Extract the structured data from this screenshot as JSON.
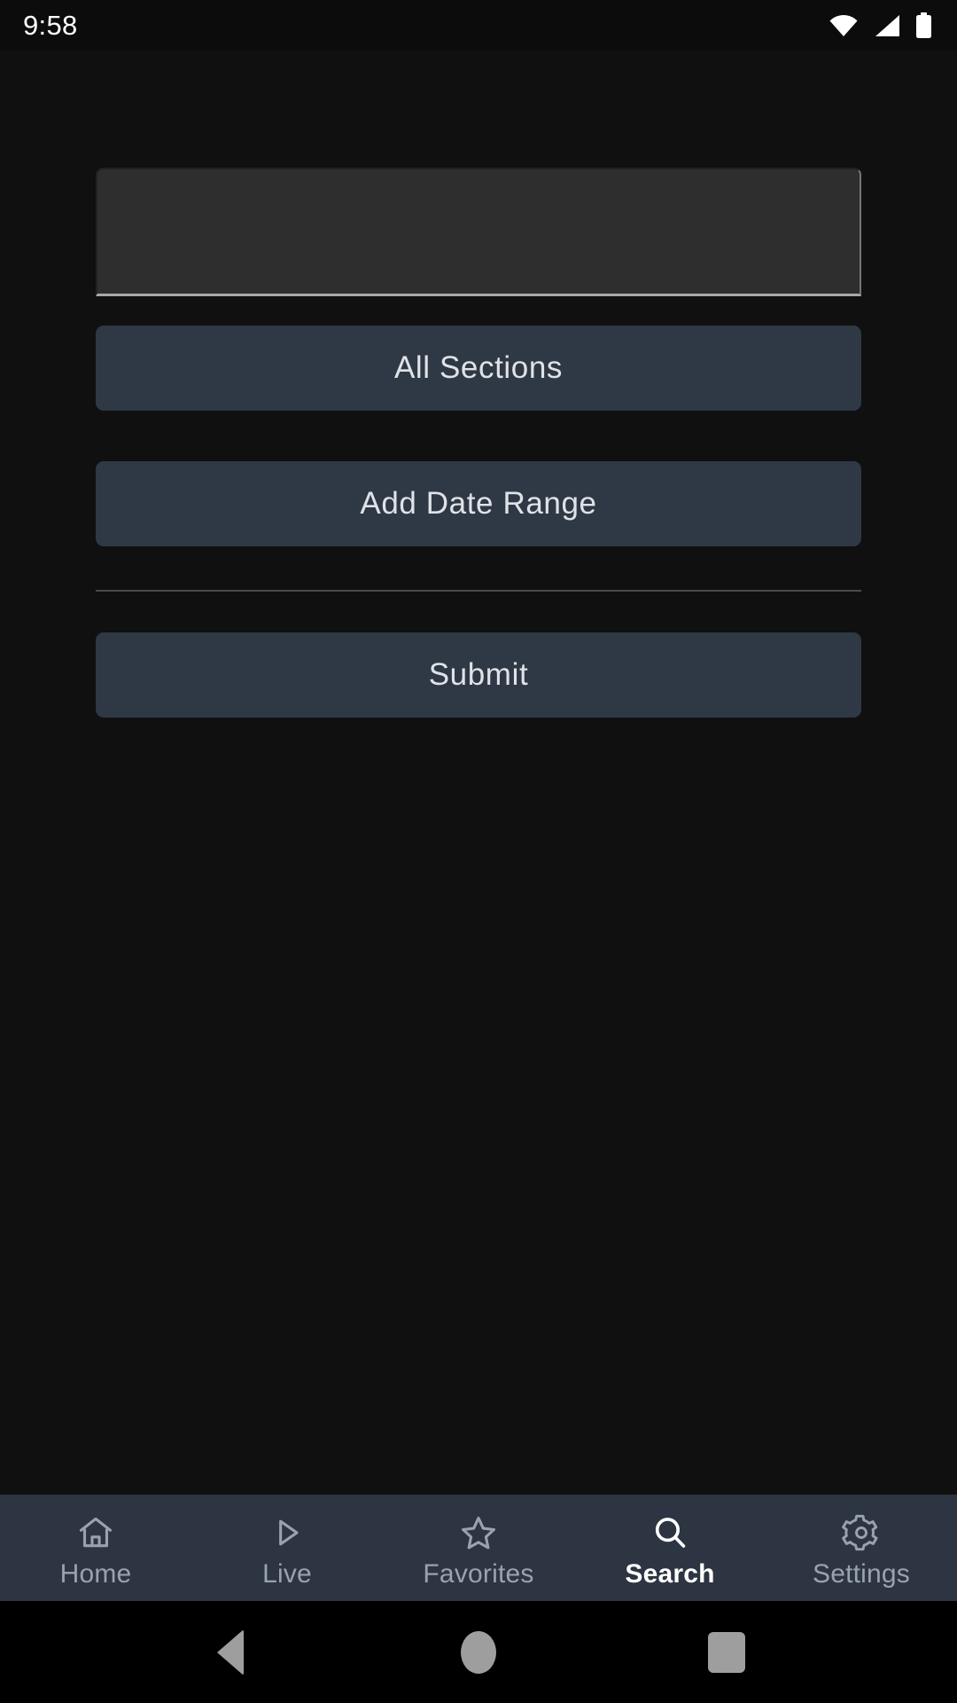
{
  "status_bar": {
    "clock": "9:58",
    "icons": [
      {
        "name": "wifi-icon"
      },
      {
        "name": "cellular-signal-icon"
      },
      {
        "name": "battery-icon"
      }
    ]
  },
  "search_form": {
    "query_value": "",
    "query_placeholder": "",
    "sections_button": "All Sections",
    "date_range_button": "Add Date Range",
    "submit_button": "Submit"
  },
  "bottom_nav": {
    "items": [
      {
        "label": "Home",
        "icon": "home-icon",
        "active": false
      },
      {
        "label": "Live",
        "icon": "play-icon",
        "active": false
      },
      {
        "label": "Favorites",
        "icon": "star-icon",
        "active": false
      },
      {
        "label": "Search",
        "icon": "search-icon",
        "active": true
      },
      {
        "label": "Settings",
        "icon": "gear-icon",
        "active": false
      }
    ]
  },
  "system_nav": {
    "back": "back-button",
    "home": "home-button",
    "recents": "recents-button"
  },
  "colors": {
    "background": "#101010",
    "field_fill": "#2e2e2e",
    "button_fill": "#2f3845",
    "nav_fill": "#2c3541",
    "accent_text": "#ffffff",
    "muted_text": "#9aa3ad"
  }
}
